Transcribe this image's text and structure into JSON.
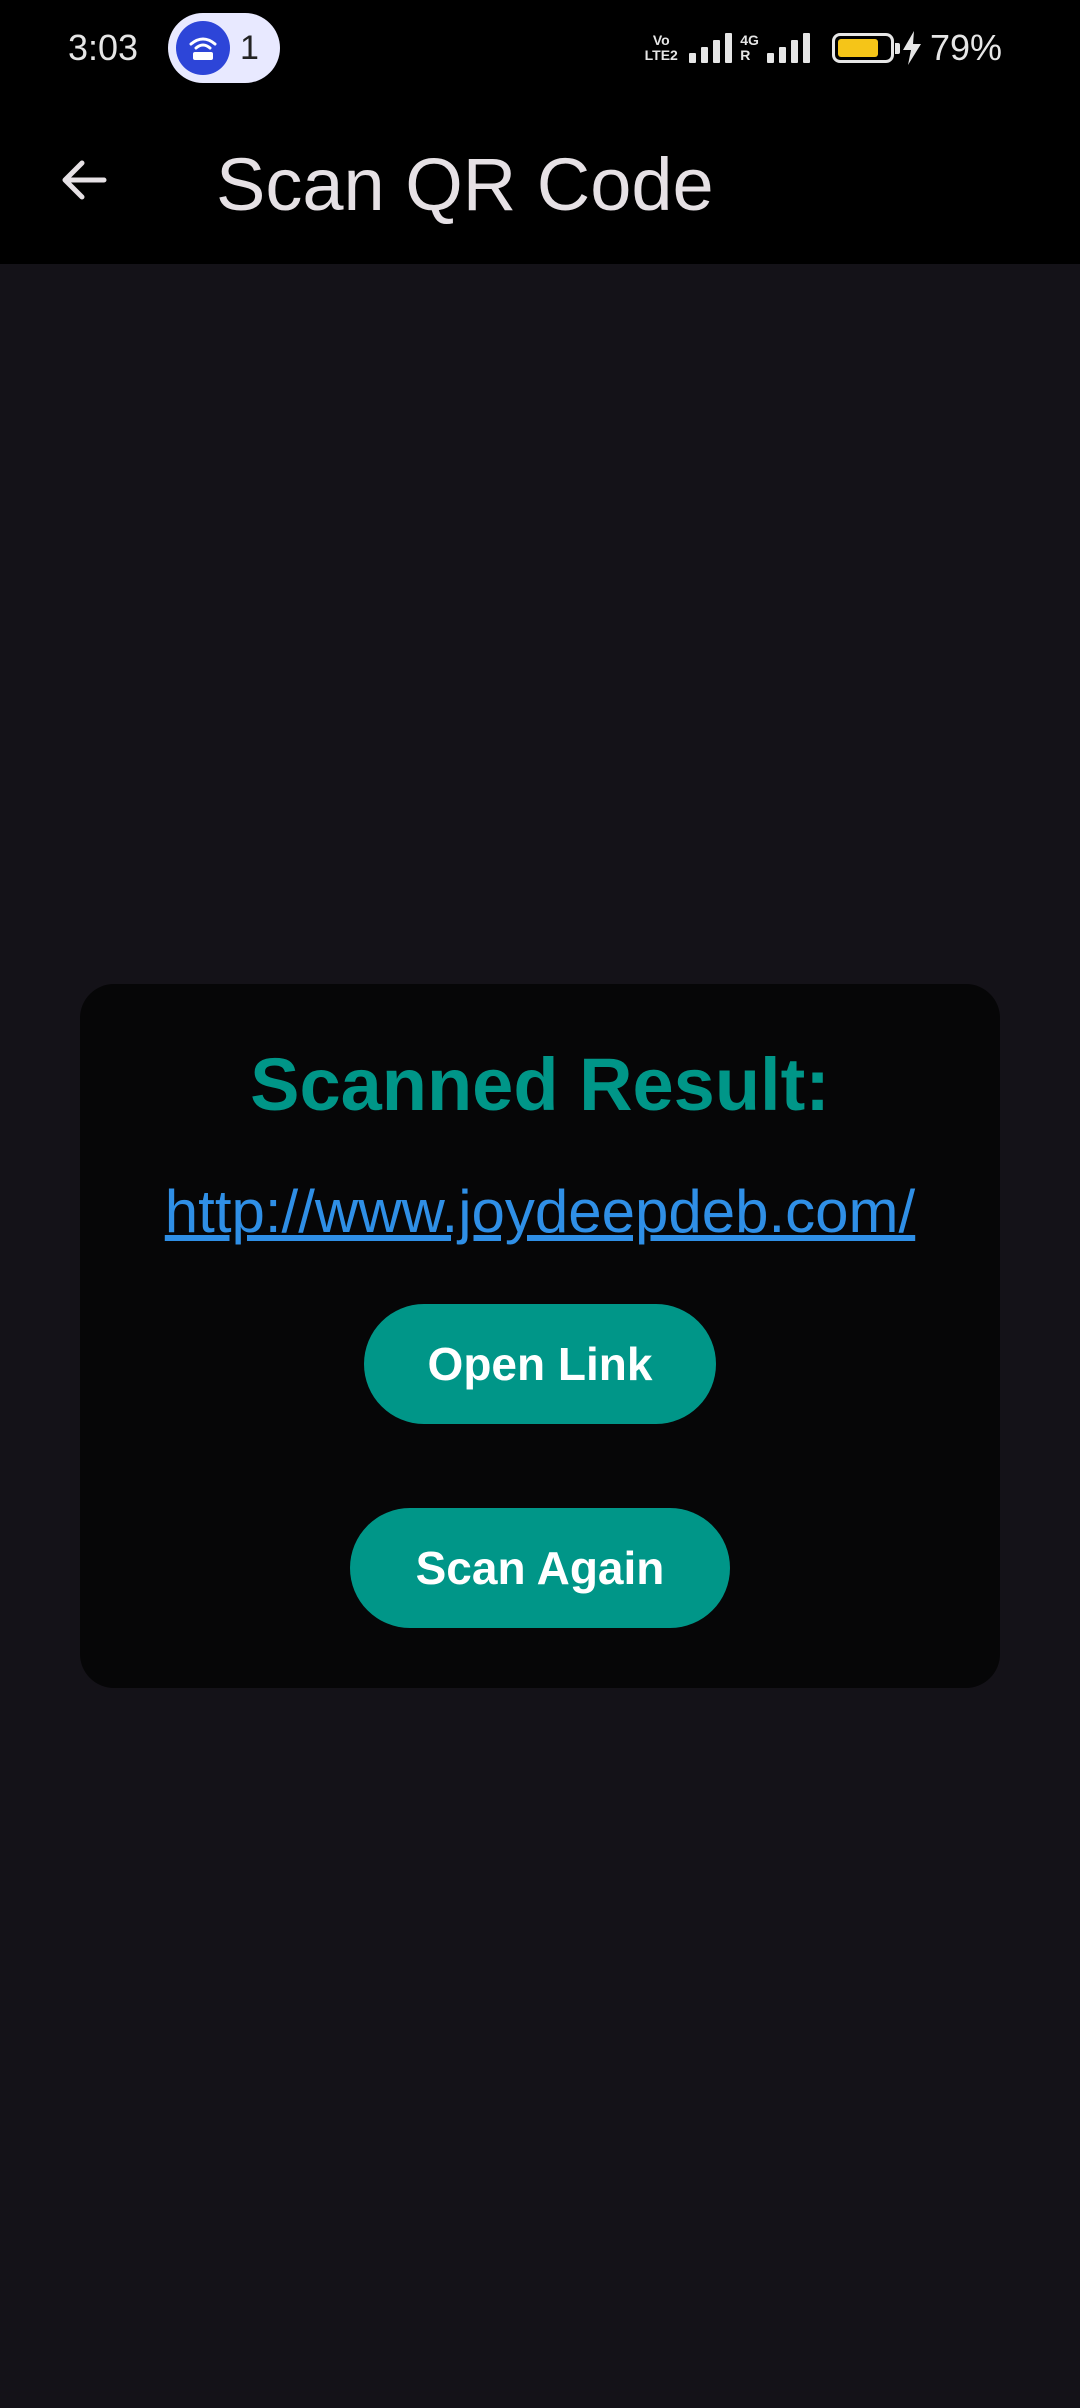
{
  "status_bar": {
    "time": "3:03",
    "hotspot_count": "1",
    "volte_top": "Vo",
    "volte_bottom": "LTE2",
    "network_up": "4G",
    "network_down": "R",
    "battery_percent": "79%",
    "battery_level": 0.79,
    "battery_color": "#f5c518",
    "icons": [
      "wifi-hotspot-icon",
      "volte-icon",
      "signal-icon",
      "4g-signal-icon",
      "battery-icon",
      "charging-bolt-icon"
    ]
  },
  "app_bar": {
    "title": "Scan QR Code",
    "back_icon": "arrow-left-icon"
  },
  "result": {
    "heading": "Scanned Result:",
    "link": "http://www.joydeepdeb.com/",
    "open_button": "Open Link",
    "scan_again_button": "Scan Again"
  },
  "colors": {
    "accent": "#009688",
    "link": "#2f8fe6",
    "background": "#141218",
    "card": "#060607"
  }
}
